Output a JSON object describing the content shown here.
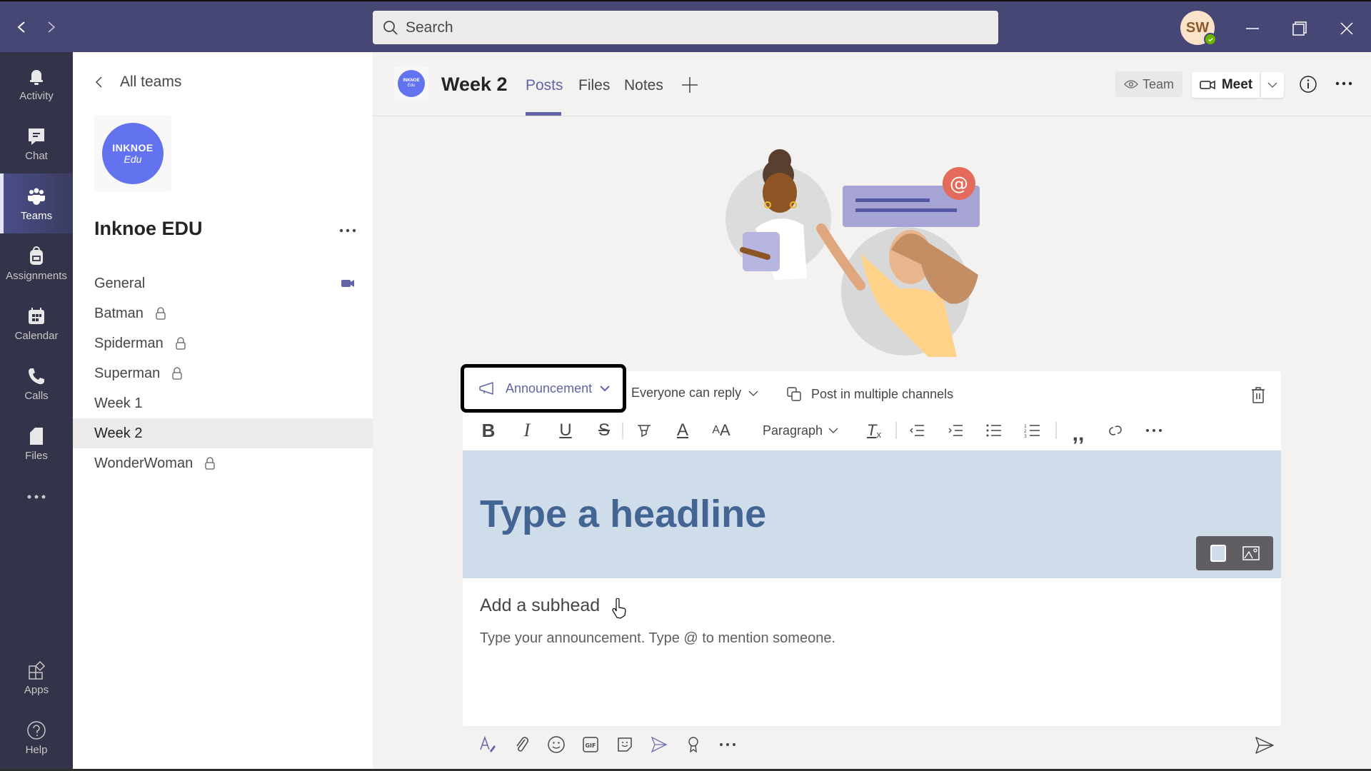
{
  "titlebar": {
    "search_placeholder": "Search",
    "user_initials": "SW",
    "presence": "available",
    "window_controls": [
      "minimize",
      "restore",
      "close"
    ]
  },
  "rail": {
    "items": [
      {
        "label": "Activity",
        "icon": "bell-icon"
      },
      {
        "label": "Chat",
        "icon": "chat-icon"
      },
      {
        "label": "Teams",
        "icon": "teams-icon",
        "active": true
      },
      {
        "label": "Assignments",
        "icon": "backpack-icon"
      },
      {
        "label": "Calendar",
        "icon": "calendar-icon"
      },
      {
        "label": "Calls",
        "icon": "phone-icon"
      },
      {
        "label": "Files",
        "icon": "file-icon"
      }
    ],
    "more": "more-apps-icon",
    "bottom": [
      {
        "label": "Apps",
        "icon": "apps-icon"
      },
      {
        "label": "Help",
        "icon": "help-icon"
      }
    ]
  },
  "panel": {
    "back_label": "All teams",
    "team_logo_line1": "INKNOE",
    "team_logo_line2": "Edu",
    "team_name": "Inknoe EDU",
    "channels": [
      {
        "name": "General",
        "private": false,
        "meeting": true
      },
      {
        "name": "Batman",
        "private": true
      },
      {
        "name": "Spiderman",
        "private": true
      },
      {
        "name": "Superman",
        "private": true
      },
      {
        "name": "Week 1",
        "private": false
      },
      {
        "name": "Week 2",
        "private": false,
        "active": true
      },
      {
        "name": "WonderWoman",
        "private": true
      }
    ]
  },
  "header": {
    "logo_line1": "INKNOE",
    "logo_line2": "Edu",
    "channel_title": "Week 2",
    "tabs": [
      {
        "label": "Posts",
        "active": true
      },
      {
        "label": "Files"
      },
      {
        "label": "Notes"
      }
    ],
    "team_button": "Team",
    "meet_button": "Meet"
  },
  "composer": {
    "post_type": "Announcement",
    "reply_setting": "Everyone can reply",
    "multi_channel": "Post in multiple channels",
    "paragraph_style": "Paragraph",
    "headline_placeholder": "Type a headline",
    "subhead_placeholder": "Add a subhead",
    "body_placeholder": "Type your announcement. Type @ to mention someone."
  },
  "colors": {
    "titlebar": "#464775",
    "rail": "#33344a",
    "accent": "#6264a7",
    "banner": "#cfdcea",
    "headline": "#436593",
    "team_logo": "#6373f0"
  }
}
